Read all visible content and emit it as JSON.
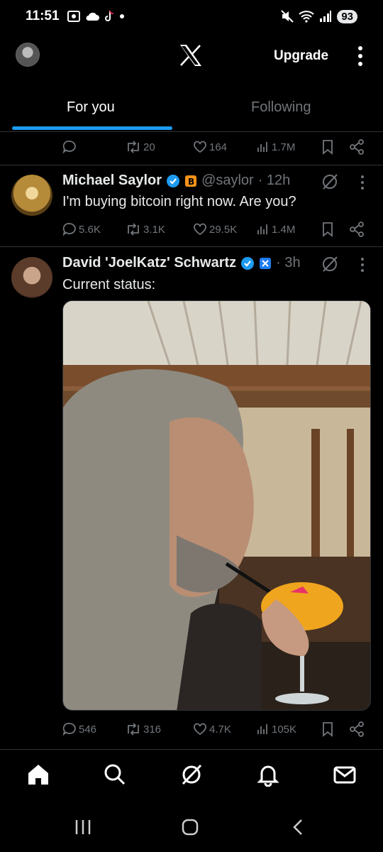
{
  "status_bar": {
    "time": "11:51",
    "battery": "93"
  },
  "header": {
    "upgrade_label": "Upgrade"
  },
  "tabs": [
    {
      "label": "For you"
    },
    {
      "label": "Following"
    }
  ],
  "prev_tweet_actions": {
    "retweets": "20",
    "likes": "164",
    "views": "1.7M"
  },
  "tweets": [
    {
      "name": "Michael Saylor",
      "handle": "@saylor",
      "time": "· 12h",
      "text": "I'm buying bitcoin right now. Are you?",
      "replies": "5.6K",
      "retweets": "3.1K",
      "likes": "29.5K",
      "views": "1.4M"
    },
    {
      "name": "David 'JoelKatz' Schwartz",
      "handle": "",
      "time": "· 3h",
      "text": "Current status:",
      "replies": "546",
      "retweets": "316",
      "likes": "4.7K",
      "views": "105K"
    }
  ],
  "colors": {
    "accent": "#1d9bf0",
    "muted": "#71767b",
    "text": "#e7e9ea",
    "verified": "#1d9bf0"
  }
}
